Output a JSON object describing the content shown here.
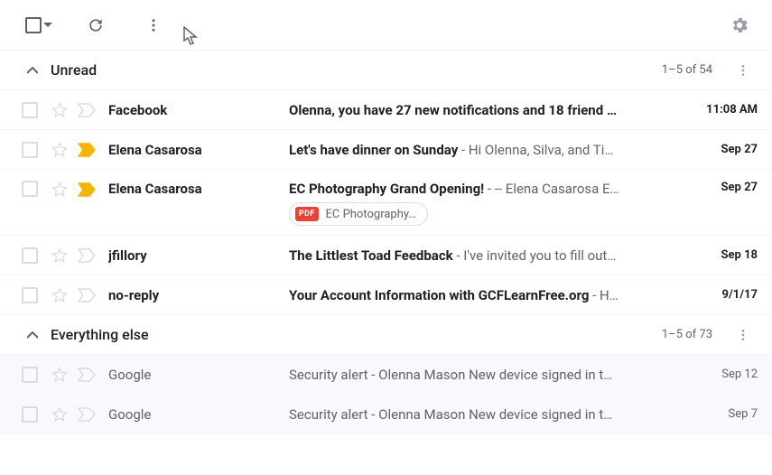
{
  "sections": {
    "unread": {
      "title": "Unread",
      "count": "1–5 of 54"
    },
    "everything": {
      "title": "Everything else",
      "count": "1–5 of 73"
    }
  },
  "emails": {
    "unread": [
      {
        "sender": "Facebook",
        "subject": "Olenna, you have 27 new notifications and 18 friend …",
        "snippet": "",
        "date": "11:08 AM",
        "important": false
      },
      {
        "sender": "Elena Casarosa",
        "subject": "Let's have dinner on Sunday",
        "snippet": " - Hi Olenna, Silva, and Ti…",
        "date": "Sep 27",
        "important": true
      },
      {
        "sender": "Elena Casarosa",
        "subject": "EC Photography Grand Opening!",
        "snippet": " - -- Elena Casarosa E…",
        "date": "Sep 27",
        "important": true,
        "attachment": "EC Photography…"
      },
      {
        "sender": "jfillory",
        "subject": "The Littlest Toad Feedback",
        "snippet": " - I've invited you to fill out…",
        "date": "Sep 18",
        "important": false
      },
      {
        "sender": "no-reply",
        "subject": "Your Account Information with GCFLearnFree.org",
        "snippet": " - H…",
        "date": "9/1/17",
        "important": false
      }
    ],
    "everything": [
      {
        "sender": "Google",
        "subject": "Security alert",
        "snippet": " - Olenna Mason New device signed in t…",
        "date": "Sep 12"
      },
      {
        "sender": "Google",
        "subject": "Security alert",
        "snippet": " - Olenna Mason New device signed in t…",
        "date": "Sep 7"
      }
    ]
  },
  "attachment_type": "PDF"
}
